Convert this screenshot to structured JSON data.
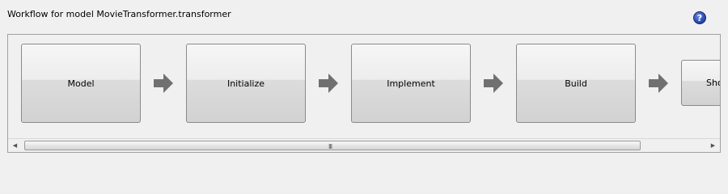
{
  "header": {
    "title": "Workflow for model MovieTransformer.transformer",
    "help_label": "?"
  },
  "workflow": {
    "steps": [
      {
        "label": "Model"
      },
      {
        "label": "Initialize"
      },
      {
        "label": "Implement"
      },
      {
        "label": "Build"
      },
      {
        "label": "Sho"
      }
    ]
  },
  "scrollbar": {
    "left_arrow": "◀",
    "right_arrow": "▶",
    "grip": "III"
  },
  "colors": {
    "arrow": "#707070",
    "help_icon": "#2f4fb8"
  }
}
